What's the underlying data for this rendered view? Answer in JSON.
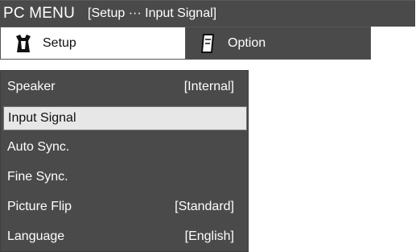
{
  "title": {
    "menu_name": "PC MENU",
    "breadcrumb": "[Setup ··· Input Signal]"
  },
  "tabs": [
    {
      "label": "Setup",
      "icon": "toolbox-icon",
      "active": true
    },
    {
      "label": "Option",
      "icon": "note-icon",
      "active": false
    }
  ],
  "menu_items": [
    {
      "label": "Speaker",
      "value": "[Internal]"
    },
    {
      "label": "Input Signal",
      "value": "",
      "selected": true
    },
    {
      "label": "Auto Sync.",
      "value": ""
    },
    {
      "label": "Fine Sync.",
      "value": ""
    },
    {
      "label": "Picture Flip",
      "value": "[Standard]"
    },
    {
      "label": "Language",
      "value": "[English]"
    }
  ],
  "colors": {
    "panel": "#4a4a4a",
    "text_light": "#ffffff",
    "highlight": "#e7e7e7"
  }
}
